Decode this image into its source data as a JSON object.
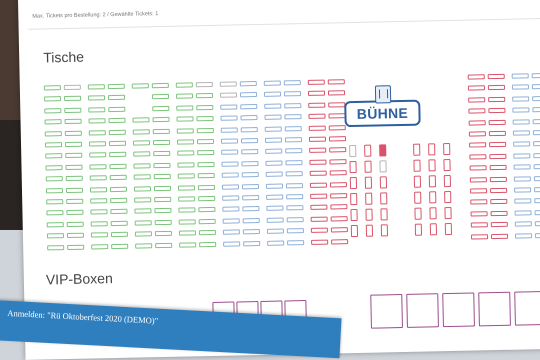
{
  "hint_text": "Max. Tickets pro Bestellung: 2 / Gewählte Tickets: 1",
  "sections": {
    "tables_title": "Tische",
    "vip_title": "VIP-Boxen"
  },
  "stage": {
    "label": "BÜHNE",
    "icon": "stage-building-icon"
  },
  "banner": {
    "text": "Anmelden: \"Rü Oktoberfest 2020 (DEMO)\""
  },
  "colors": {
    "green": "#7cc47c",
    "blue": "#8fb0d8",
    "red": "#d9546a",
    "grey": "#b5b5b5",
    "vip": "#9c4d8e",
    "stage": "#2e5f9e",
    "banner": "#2f7fbf"
  },
  "legend_states": [
    "available",
    "selected",
    "occupied"
  ]
}
